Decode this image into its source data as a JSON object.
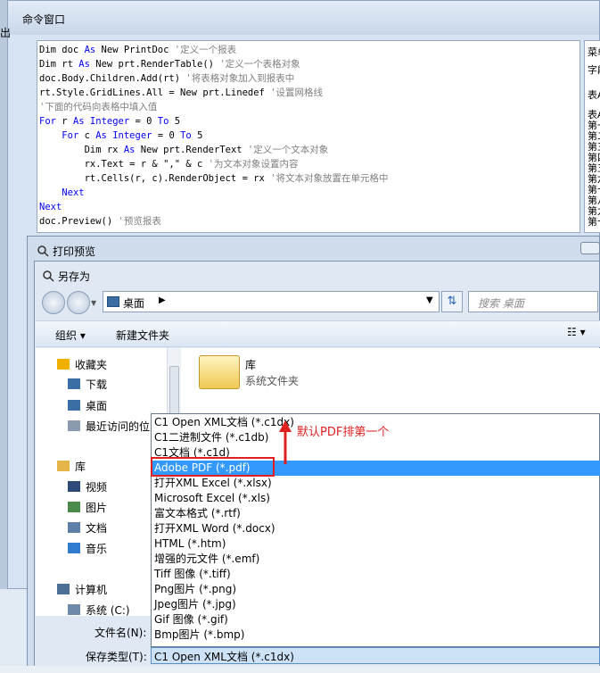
{
  "cmd_window": {
    "title": "命令窗口",
    "left_edge": "出",
    "code_lines": [
      {
        "parts": [
          {
            "t": "Dim doc ",
            "c": ""
          },
          {
            "t": "As",
            "c": "kw"
          },
          {
            "t": " New PrintDoc ",
            "c": ""
          },
          {
            "t": "'定义一个报表",
            "c": "cm"
          }
        ]
      },
      {
        "parts": [
          {
            "t": "Dim rt ",
            "c": ""
          },
          {
            "t": "As",
            "c": "kw"
          },
          {
            "t": " New prt.RenderTable() ",
            "c": ""
          },
          {
            "t": "'定义一个表格对象",
            "c": "cm"
          }
        ]
      },
      {
        "parts": [
          {
            "t": "doc.Body.Children.Add(rt) ",
            "c": ""
          },
          {
            "t": "'将表格对象加入到报表中",
            "c": "cm"
          }
        ]
      },
      {
        "parts": [
          {
            "t": "rt.Style.GridLines.All = New prt.Linedef ",
            "c": ""
          },
          {
            "t": "'设置网格线",
            "c": "cm"
          }
        ]
      },
      {
        "parts": [
          {
            "t": "'下面的代码向表格中填入值",
            "c": "cm"
          }
        ]
      },
      {
        "parts": [
          {
            "t": "For",
            "c": "kw"
          },
          {
            "t": " r ",
            "c": ""
          },
          {
            "t": "As",
            "c": "kw"
          },
          {
            "t": " ",
            "c": ""
          },
          {
            "t": "Integer",
            "c": "kw"
          },
          {
            "t": " = 0 ",
            "c": ""
          },
          {
            "t": "To",
            "c": "kw"
          },
          {
            "t": " 5",
            "c": ""
          }
        ]
      },
      {
        "parts": [
          {
            "t": "    ",
            "c": ""
          },
          {
            "t": "For",
            "c": "kw"
          },
          {
            "t": " c ",
            "c": ""
          },
          {
            "t": "As",
            "c": "kw"
          },
          {
            "t": " ",
            "c": ""
          },
          {
            "t": "Integer",
            "c": "kw"
          },
          {
            "t": " = 0 ",
            "c": ""
          },
          {
            "t": "To",
            "c": "kw"
          },
          {
            "t": " 5",
            "c": ""
          }
        ]
      },
      {
        "parts": [
          {
            "t": "        Dim rx ",
            "c": ""
          },
          {
            "t": "As",
            "c": "kw"
          },
          {
            "t": " New prt.RenderText ",
            "c": ""
          },
          {
            "t": "'定义一个文本对象",
            "c": "cm"
          }
        ]
      },
      {
        "parts": [
          {
            "t": "        rx.Text = r & \",\" & c ",
            "c": ""
          },
          {
            "t": "'为文本对象设置内容",
            "c": "cm"
          }
        ]
      },
      {
        "parts": [
          {
            "t": "        rt.Cells(r, c).RenderObject = rx ",
            "c": ""
          },
          {
            "t": "'将文本对象放置在单元格中",
            "c": "cm"
          }
        ]
      },
      {
        "parts": [
          {
            "t": "    ",
            "c": ""
          },
          {
            "t": "Next",
            "c": "kw"
          }
        ]
      },
      {
        "parts": [
          {
            "t": "Next",
            "c": "kw"
          }
        ]
      },
      {
        "parts": [
          {
            "t": "doc.Preview() ",
            "c": ""
          },
          {
            "t": "'预览报表",
            "c": "cm"
          }
        ]
      }
    ],
    "right_panel": [
      "菜单",
      "字段",
      "表A",
      "表A",
      "第一",
      "第二",
      "第三",
      "第四",
      "第五",
      "第六",
      "第七",
      "第八",
      "第九",
      "第十"
    ]
  },
  "print_preview": {
    "title": "打印预览"
  },
  "save_dialog": {
    "title": "另存为",
    "address": "桌面",
    "search_placeholder": "搜索 桌面",
    "organize": "组织 ▾",
    "new_folder": "新建文件夹",
    "nav_items": [
      "收藏夹",
      "下载",
      "桌面",
      "最近访问的位置",
      "库",
      "视频",
      "图片",
      "文档",
      "音乐",
      "计算机",
      "系统 (C:)"
    ],
    "library": {
      "name": "库",
      "type": "系统文件夹"
    },
    "filename_label": "文件名(N):",
    "filetype_label": "保存类型(T):",
    "filetype_value": "C1 Open XML文档 (*.c1dx)"
  },
  "file_types": [
    "C1 Open XML文档 (*.c1dx)",
    "C1二进制文件 (*.c1db)",
    "C1文档 (*.c1d)",
    "Adobe PDF (*.pdf)",
    "打开XML Excel (*.xlsx)",
    "Microsoft Excel (*.xls)",
    "富文本格式 (*.rtf)",
    "打开XML Word (*.docx)",
    "HTML (*.htm)",
    "增强的元文件 (*.emf)",
    "Tiff 图像 (*.tiff)",
    "Png图片 (*.png)",
    "Jpeg图片 (*.jpg)",
    "Gif 图像 (*.gif)",
    "Bmp图片 (*.bmp)"
  ],
  "selected_type": "Adobe PDF (*.pdf)",
  "annotation": "默认PDF排第一个",
  "colors": {
    "selection": "#3399ff",
    "annotation": "#e02020",
    "keyword": "#0000ff",
    "comment": "#808080"
  }
}
